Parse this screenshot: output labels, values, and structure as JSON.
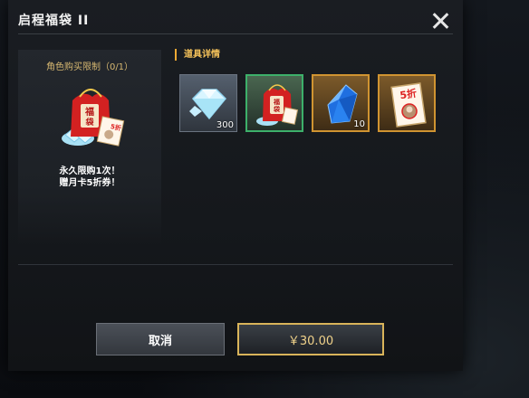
{
  "dialog": {
    "title": "启程福袋 II",
    "close_icon": "close-icon"
  },
  "left_panel": {
    "limit_text": "角色购买限制（0/1）",
    "bag_icon": "lucky-bag-icon",
    "desc_line1": "永久限购1次！",
    "desc_line2": "赠月卡5折券！"
  },
  "items_section": {
    "label": "道具详情",
    "items": [
      {
        "icon": "diamond-icon",
        "count": "300",
        "rarity": "grey"
      },
      {
        "icon": "lucky-bag-icon",
        "count": "",
        "rarity": "green"
      },
      {
        "icon": "blue-crystal-icon",
        "count": "10",
        "rarity": "orange"
      },
      {
        "icon": "discount-coupon-icon",
        "count": "",
        "rarity": "orange"
      }
    ]
  },
  "buttons": {
    "cancel_label": "取消",
    "buy_label": "￥30.00"
  },
  "colors": {
    "accent_gold": "#d9b45a",
    "section_label": "#f5c25a",
    "rarity_green": "#3db06a",
    "rarity_orange": "#d09431"
  }
}
